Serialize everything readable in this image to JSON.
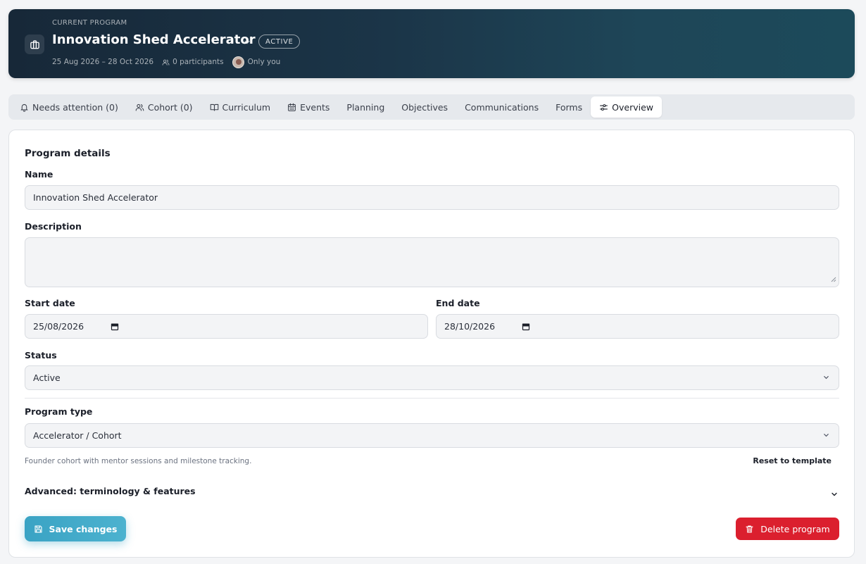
{
  "header": {
    "eyebrow": "CURRENT PROGRAM",
    "title": "Innovation Shed Accelerator",
    "status_badge": "ACTIVE",
    "date_range": "25 Aug 2026 – 28 Oct 2026",
    "participants": "0 participants",
    "visibility": "Only you"
  },
  "tabs": [
    {
      "label": "Needs attention (0)",
      "icon": "bell-icon"
    },
    {
      "label": "Cohort (0)",
      "icon": "users-icon"
    },
    {
      "label": "Curriculum",
      "icon": "book-icon"
    },
    {
      "label": "Events",
      "icon": "calendar-icon"
    },
    {
      "label": "Planning"
    },
    {
      "label": "Objectives"
    },
    {
      "label": "Communications"
    },
    {
      "label": "Forms"
    },
    {
      "label": "Overview",
      "icon": "sliders-icon",
      "active": true
    }
  ],
  "form": {
    "section_title": "Program details",
    "name_label": "Name",
    "name_value": "Innovation Shed Accelerator",
    "description_label": "Description",
    "description_value": "",
    "start_label": "Start date",
    "start_value": "25/08/2026",
    "end_label": "End date",
    "end_value": "28/10/2026",
    "status_label": "Status",
    "status_value": "Active",
    "type_label": "Program type",
    "type_value": "Accelerator / Cohort",
    "type_hint": "Founder cohort with mentor sessions and milestone tracking.",
    "reset_label": "Reset to template",
    "advanced_label": "Advanced: terminology & features"
  },
  "actions": {
    "save_label": "Save changes",
    "delete_label": "Delete program"
  },
  "colors": {
    "accent": "#3aa3c4",
    "danger": "#db1f2e",
    "banner": "#1b3548"
  }
}
